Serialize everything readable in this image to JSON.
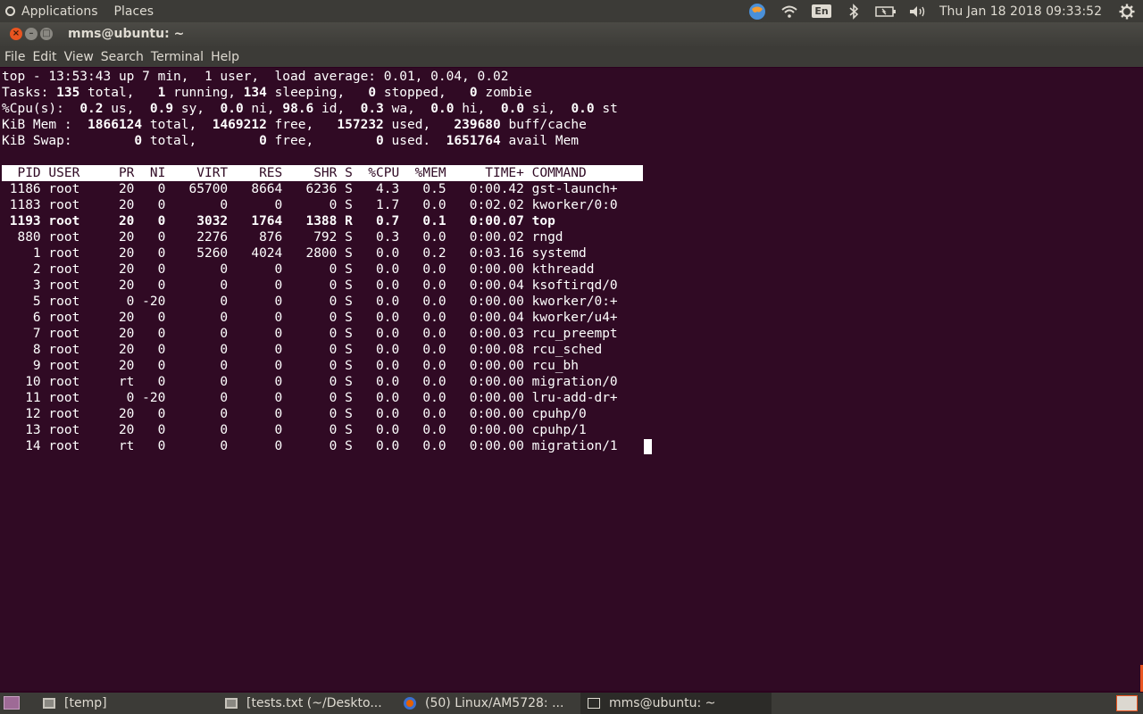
{
  "top_panel": {
    "applications": "Applications",
    "places": "Places",
    "language": "En",
    "clock": "Thu Jan 18 2018 09:33:52"
  },
  "window": {
    "title": "mms@ubuntu: ~",
    "close": "×",
    "minimize": "–",
    "maximize": "□"
  },
  "menu": [
    "File",
    "Edit",
    "View",
    "Search",
    "Terminal",
    "Help"
  ],
  "top_summary": [
    [
      {
        "t": "top - 13:53:43 up 7 min,  1 user,  load average: 0.01, 0.04, 0.02"
      }
    ],
    [
      {
        "t": "Tasks: "
      },
      {
        "t": "135",
        "b": 1
      },
      {
        "t": " total,   "
      },
      {
        "t": "1",
        "b": 1
      },
      {
        "t": " running, "
      },
      {
        "t": "134",
        "b": 1
      },
      {
        "t": " sleeping,   "
      },
      {
        "t": "0",
        "b": 1
      },
      {
        "t": " stopped,   "
      },
      {
        "t": "0",
        "b": 1
      },
      {
        "t": " zombie"
      }
    ],
    [
      {
        "t": "%Cpu(s):  "
      },
      {
        "t": "0.2",
        "b": 1
      },
      {
        "t": " us,  "
      },
      {
        "t": "0.9",
        "b": 1
      },
      {
        "t": " sy,  "
      },
      {
        "t": "0.0",
        "b": 1
      },
      {
        "t": " ni, "
      },
      {
        "t": "98.6",
        "b": 1
      },
      {
        "t": " id,  "
      },
      {
        "t": "0.3",
        "b": 1
      },
      {
        "t": " wa,  "
      },
      {
        "t": "0.0",
        "b": 1
      },
      {
        "t": " hi,  "
      },
      {
        "t": "0.0",
        "b": 1
      },
      {
        "t": " si,  "
      },
      {
        "t": "0.0",
        "b": 1
      },
      {
        "t": " st"
      }
    ],
    [
      {
        "t": "KiB Mem :  "
      },
      {
        "t": "1866124",
        "b": 1
      },
      {
        "t": " total,  "
      },
      {
        "t": "1469212",
        "b": 1
      },
      {
        "t": " free,   "
      },
      {
        "t": "157232",
        "b": 1
      },
      {
        "t": " used,   "
      },
      {
        "t": "239680",
        "b": 1
      },
      {
        "t": " buff/cache"
      }
    ],
    [
      {
        "t": "KiB Swap:        "
      },
      {
        "t": "0",
        "b": 1
      },
      {
        "t": " total,        "
      },
      {
        "t": "0",
        "b": 1
      },
      {
        "t": " free,        "
      },
      {
        "t": "0",
        "b": 1
      },
      {
        "t": " used.  "
      },
      {
        "t": "1651764",
        "b": 1
      },
      {
        "t": " avail Mem"
      }
    ]
  ],
  "process_table": {
    "columns": [
      "PID",
      "USER",
      "PR",
      "NI",
      "VIRT",
      "RES",
      "SHR",
      "S",
      "%CPU",
      "%MEM",
      "TIME+",
      "COMMAND"
    ],
    "rows": [
      {
        "pid": "1186",
        "user": "root",
        "pr": "20",
        "ni": "0",
        "virt": "65700",
        "res": "8664",
        "shr": "6236",
        "s": "S",
        "cpu": "4.3",
        "mem": "0.5",
        "time": "0:00.42",
        "cmd": "gst-launch+"
      },
      {
        "pid": "1183",
        "user": "root",
        "pr": "20",
        "ni": "0",
        "virt": "0",
        "res": "0",
        "shr": "0",
        "s": "S",
        "cpu": "1.7",
        "mem": "0.0",
        "time": "0:02.02",
        "cmd": "kworker/0:0"
      },
      {
        "pid": "1193",
        "user": "root",
        "pr": "20",
        "ni": "0",
        "virt": "3032",
        "res": "1764",
        "shr": "1388",
        "s": "R",
        "cpu": "0.7",
        "mem": "0.1",
        "time": "0:00.07",
        "cmd": "top",
        "bold": true
      },
      {
        "pid": "880",
        "user": "root",
        "pr": "20",
        "ni": "0",
        "virt": "2276",
        "res": "876",
        "shr": "792",
        "s": "S",
        "cpu": "0.3",
        "mem": "0.0",
        "time": "0:00.02",
        "cmd": "rngd"
      },
      {
        "pid": "1",
        "user": "root",
        "pr": "20",
        "ni": "0",
        "virt": "5260",
        "res": "4024",
        "shr": "2800",
        "s": "S",
        "cpu": "0.0",
        "mem": "0.2",
        "time": "0:03.16",
        "cmd": "systemd"
      },
      {
        "pid": "2",
        "user": "root",
        "pr": "20",
        "ni": "0",
        "virt": "0",
        "res": "0",
        "shr": "0",
        "s": "S",
        "cpu": "0.0",
        "mem": "0.0",
        "time": "0:00.00",
        "cmd": "kthreadd"
      },
      {
        "pid": "3",
        "user": "root",
        "pr": "20",
        "ni": "0",
        "virt": "0",
        "res": "0",
        "shr": "0",
        "s": "S",
        "cpu": "0.0",
        "mem": "0.0",
        "time": "0:00.04",
        "cmd": "ksoftirqd/0"
      },
      {
        "pid": "5",
        "user": "root",
        "pr": "0",
        "ni": "-20",
        "virt": "0",
        "res": "0",
        "shr": "0",
        "s": "S",
        "cpu": "0.0",
        "mem": "0.0",
        "time": "0:00.00",
        "cmd": "kworker/0:+"
      },
      {
        "pid": "6",
        "user": "root",
        "pr": "20",
        "ni": "0",
        "virt": "0",
        "res": "0",
        "shr": "0",
        "s": "S",
        "cpu": "0.0",
        "mem": "0.0",
        "time": "0:00.04",
        "cmd": "kworker/u4+"
      },
      {
        "pid": "7",
        "user": "root",
        "pr": "20",
        "ni": "0",
        "virt": "0",
        "res": "0",
        "shr": "0",
        "s": "S",
        "cpu": "0.0",
        "mem": "0.0",
        "time": "0:00.03",
        "cmd": "rcu_preempt"
      },
      {
        "pid": "8",
        "user": "root",
        "pr": "20",
        "ni": "0",
        "virt": "0",
        "res": "0",
        "shr": "0",
        "s": "S",
        "cpu": "0.0",
        "mem": "0.0",
        "time": "0:00.08",
        "cmd": "rcu_sched"
      },
      {
        "pid": "9",
        "user": "root",
        "pr": "20",
        "ni": "0",
        "virt": "0",
        "res": "0",
        "shr": "0",
        "s": "S",
        "cpu": "0.0",
        "mem": "0.0",
        "time": "0:00.00",
        "cmd": "rcu_bh"
      },
      {
        "pid": "10",
        "user": "root",
        "pr": "rt",
        "ni": "0",
        "virt": "0",
        "res": "0",
        "shr": "0",
        "s": "S",
        "cpu": "0.0",
        "mem": "0.0",
        "time": "0:00.00",
        "cmd": "migration/0"
      },
      {
        "pid": "11",
        "user": "root",
        "pr": "0",
        "ni": "-20",
        "virt": "0",
        "res": "0",
        "shr": "0",
        "s": "S",
        "cpu": "0.0",
        "mem": "0.0",
        "time": "0:00.00",
        "cmd": "lru-add-dr+"
      },
      {
        "pid": "12",
        "user": "root",
        "pr": "20",
        "ni": "0",
        "virt": "0",
        "res": "0",
        "shr": "0",
        "s": "S",
        "cpu": "0.0",
        "mem": "0.0",
        "time": "0:00.00",
        "cmd": "cpuhp/0"
      },
      {
        "pid": "13",
        "user": "root",
        "pr": "20",
        "ni": "0",
        "virt": "0",
        "res": "0",
        "shr": "0",
        "s": "S",
        "cpu": "0.0",
        "mem": "0.0",
        "time": "0:00.00",
        "cmd": "cpuhp/1"
      },
      {
        "pid": "14",
        "user": "root",
        "pr": "rt",
        "ni": "0",
        "virt": "0",
        "res": "0",
        "shr": "0",
        "s": "S",
        "cpu": "0.0",
        "mem": "0.0",
        "time": "0:00.00",
        "cmd": "migration/1"
      }
    ]
  },
  "taskbar": {
    "items": [
      {
        "label": "[temp]",
        "icon": "text-editor-icon"
      },
      {
        "label": "[tests.txt (~/Deskto...",
        "icon": "text-editor-icon"
      },
      {
        "label": "(50) Linux/AM5728: ...",
        "icon": "firefox-icon"
      },
      {
        "label": "mms@ubuntu: ~",
        "icon": "terminal-icon"
      }
    ]
  },
  "colors": {
    "terminal_bg": "#300a24",
    "panel_bg": "#3c3b37",
    "accent": "#e95420"
  }
}
